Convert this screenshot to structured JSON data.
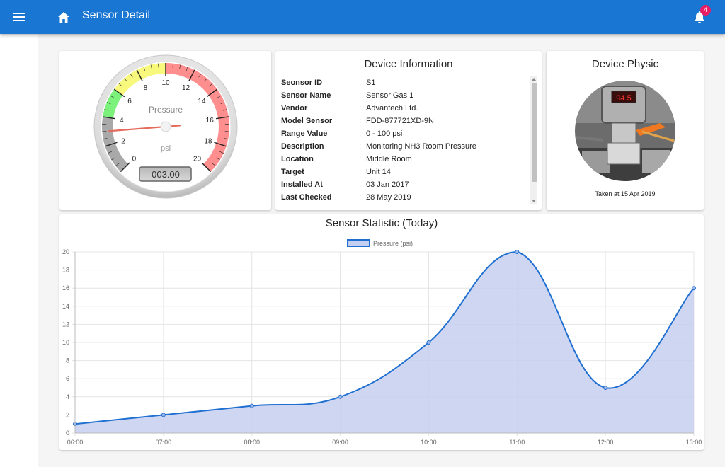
{
  "header": {
    "title": "Sensor Detail",
    "notification_count": "4"
  },
  "gauge": {
    "label": "Pressure",
    "unit": "psi",
    "value": 3.0,
    "display": "003.00",
    "min": 0,
    "max": 20,
    "major_ticks": [
      "0",
      "2",
      "4",
      "6",
      "8",
      "10",
      "12",
      "14",
      "16",
      "18",
      "20"
    ],
    "zones": [
      {
        "from": 0,
        "to": 4,
        "color": "#a9a9a9"
      },
      {
        "from": 4,
        "to": 6,
        "color": "#7cf27c"
      },
      {
        "from": 6,
        "to": 10,
        "color": "#f8f87c"
      },
      {
        "from": 10,
        "to": 20,
        "color": "#ff8f8f"
      }
    ]
  },
  "device_info": {
    "title": "Device Information",
    "rows": [
      {
        "label": "Seonsor ID",
        "value": "S1"
      },
      {
        "label": "Sensor Name",
        "value": "Sensor Gas 1"
      },
      {
        "label": "Vendor",
        "value": "Advantech Ltd."
      },
      {
        "label": "Model Sensor",
        "value": "FDD-877721XD-9N"
      },
      {
        "label": "Range Value",
        "value": "0 - 100 psi"
      },
      {
        "label": "Description",
        "value": "Monitoring NH3 Room Pressure"
      },
      {
        "label": "Location",
        "value": "Middle Room"
      },
      {
        "label": "Target",
        "value": "Unit 14"
      },
      {
        "label": "Installed At",
        "value": "03 Jan 2017"
      },
      {
        "label": "Last Checked",
        "value": "28 May 2019"
      }
    ]
  },
  "device_physic": {
    "title": "Device Physic",
    "display_reading": "94.5",
    "caption": "Taken at 15 Apr 2019"
  },
  "chart_title": "Sensor Statistic (Today)",
  "chart_data": {
    "type": "area",
    "title": "Sensor Statistic (Today)",
    "categories": [
      "06:00",
      "07:00",
      "08:00",
      "09:00",
      "10:00",
      "11:00",
      "12:00",
      "13:00"
    ],
    "series": [
      {
        "name": "Pressure (psi)",
        "values": [
          1,
          2,
          3,
          4,
          10,
          20,
          5,
          16
        ]
      }
    ],
    "yticks": [
      "0",
      "2",
      "4",
      "6",
      "8",
      "10",
      "12",
      "14",
      "16",
      "18",
      "20"
    ],
    "ylim": [
      0,
      20
    ],
    "grid": true,
    "legend": "top-center",
    "line_color": "#1f6fd1",
    "fill_color": "#c5cff0"
  }
}
